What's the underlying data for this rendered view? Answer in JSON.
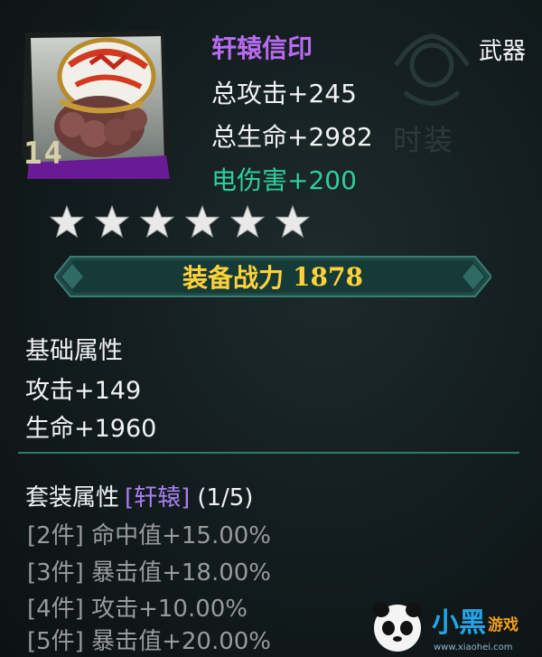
{
  "item": {
    "name": "轩辕信印",
    "type": "武器",
    "level": "14",
    "stats": [
      "总攻击+245",
      "总生命+2982",
      "电伤害+200"
    ],
    "star_count": 6
  },
  "watermark": {
    "text": "时装"
  },
  "combat_power": {
    "label": "装备战力",
    "value": "1878"
  },
  "base_attributes": {
    "title": "基础属性",
    "lines": [
      "攻击+149",
      "生命+1960"
    ]
  },
  "set_attributes": {
    "title": "套装属性",
    "set_name": "[轩辕]",
    "count": "(1/5)",
    "bonuses": [
      "[2件] 命中值+15.00%",
      "[3件] 暴击值+18.00%",
      "[4件] 攻击+10.00%",
      "[5件] 暴击值+20.00%"
    ]
  },
  "logo": {
    "text": "小黑游戏",
    "url_text": "www.xiaohei.com"
  },
  "colors": {
    "name": "#b96bf0",
    "electric": "#2fcf9a",
    "power": "#ffd23a",
    "set_name": "#a77ff0",
    "inactive": "#9a9a9a"
  }
}
